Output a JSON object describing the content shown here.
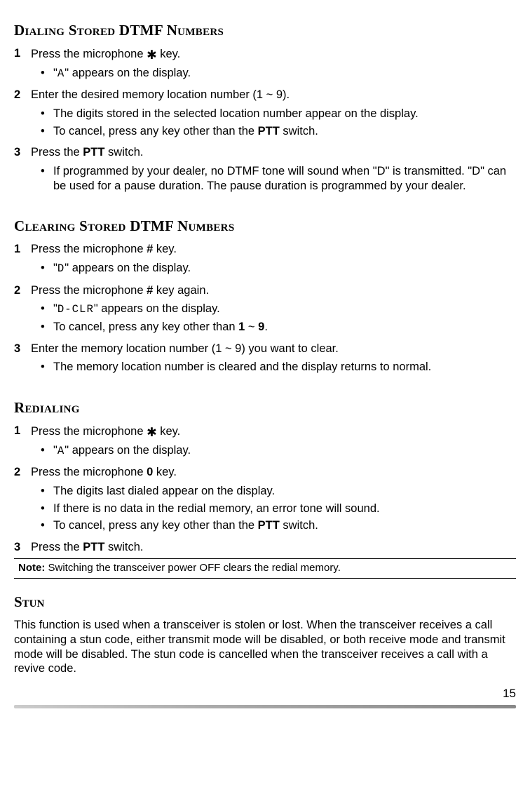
{
  "sections": {
    "dialing": {
      "heading": "Dialing Stored DTMF Numbers",
      "step1": {
        "num": "1",
        "text_a": "Press the microphone ",
        "text_b": " key."
      },
      "step1_b1": {
        "a": "\"",
        "b": "\" appears on the display."
      },
      "step2": {
        "num": "2",
        "text": "Enter the desired memory location number (1 ~ 9)."
      },
      "step2_b1": "The digits stored in the selected location number appear on the display.",
      "step2_b2_a": "To cancel, press any key other than the ",
      "step2_b2_bold": "PTT",
      "step2_b2_b": " switch.",
      "step3": {
        "num": "3",
        "text_a": "Press the ",
        "bold": "PTT",
        "text_b": " switch."
      },
      "step3_b1": "If programmed by your dealer, no DTMF tone will sound when \"D\" is transmitted.  \"D\" can be used for a pause duration.  The pause duration is programmed by your dealer."
    },
    "clearing": {
      "heading": "Clearing Stored DTMF Numbers",
      "step1": {
        "num": "1",
        "text_a": "Press the microphone ",
        "bold": "#",
        "text_b": " key."
      },
      "step1_b1": {
        "a": "\"",
        "b": "\" appears on the display."
      },
      "step2": {
        "num": "2",
        "text_a": "Press the microphone ",
        "bold": "#",
        "text_b": " key again."
      },
      "step2_b1": {
        "a": "\"",
        "b": "\" appears on the display."
      },
      "step2_b2_a": "To cancel, press any key other than ",
      "step2_b2_bold1": "1",
      "step2_b2_mid": " ~ ",
      "step2_b2_bold2": "9",
      "step2_b2_end": ".",
      "step3": {
        "num": "3",
        "text": "Enter the memory location number (1 ~ 9) you want to clear."
      },
      "step3_b1": "The memory location number is cleared and the display returns to normal."
    },
    "redialing": {
      "heading": "Redialing",
      "step1": {
        "num": "1",
        "text_a": "Press the microphone ",
        "text_b": " key."
      },
      "step1_b1": {
        "a": "\"",
        "b": "\" appears on the display."
      },
      "step2": {
        "num": "2",
        "text_a": "Press the microphone ",
        "bold": "0",
        "text_b": " key."
      },
      "step2_b1": "The digits last dialed appear on the display.",
      "step2_b2": "If there is no data in the redial memory, an error tone will sound.",
      "step2_b3_a": "To cancel, press any key other than the ",
      "step2_b3_bold": "PTT",
      "step2_b3_b": " switch.",
      "step3": {
        "num": "3",
        "text_a": "Press the ",
        "bold": "PTT",
        "text_b": " switch."
      }
    },
    "note": {
      "label": "Note:",
      "text": "  Switching the transceiver power OFF clears the redial memory."
    },
    "stun": {
      "heading": "Stun",
      "body": "This function is used when a transceiver is stolen or lost.  When the transceiver receives a call containing a stun code, either transmit mode will be disabled, or both receive mode and transmit mode will be disabled.  The stun code is cancelled when the transceiver receives a call with a revive code."
    }
  },
  "lcd": {
    "A": "A",
    "D": "D",
    "DCLR": "D-CLR"
  },
  "glyphs": {
    "star": "✱",
    "bullet": "•"
  },
  "page_number": "15"
}
